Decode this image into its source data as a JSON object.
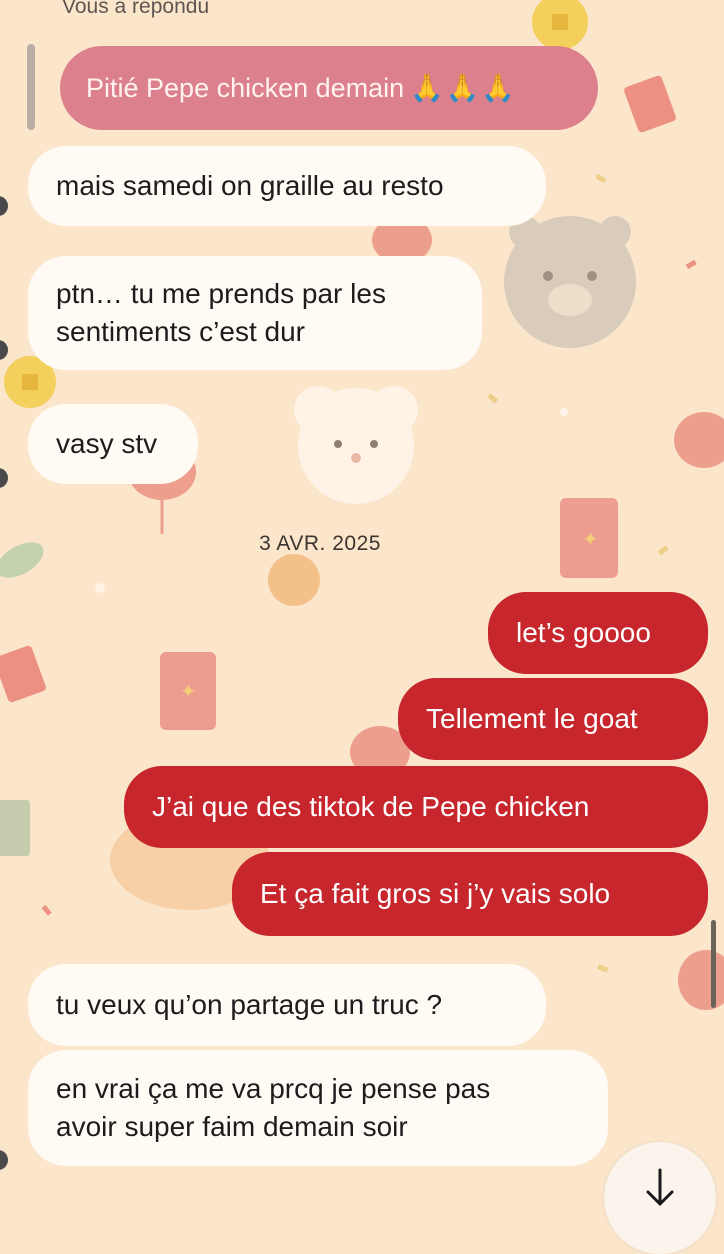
{
  "reply": {
    "label": "Vous a répondu",
    "text": "Pitié Pepe chicken demain",
    "emoji": "🙏🙏🙏"
  },
  "messages_before": [
    {
      "text": "mais samedi on graille au resto"
    },
    {
      "line1": "ptn… tu me prends par les",
      "line2": "sentiments c’est dur"
    },
    {
      "text": "vasy stv"
    }
  ],
  "date_separator": "3 AVR. 2025",
  "sent": [
    "let’s goooo",
    "Tellement le goat",
    "J’ai que des tiktok de Pepe chicken",
    "Et ça fait gros si j’y vais solo"
  ],
  "messages_after": [
    {
      "text": "tu veux qu’on partage un truc ?"
    },
    {
      "line1": "en vrai ça me va prcq je pense pas",
      "line2": "avoir super faim demain soir"
    }
  ],
  "colors": {
    "background": "#fbe6cc",
    "incoming_bubble": "#fffaf3",
    "outgoing_bubble": "#c7262d",
    "reply_bubble": "#db7b89"
  },
  "icons": {
    "scroll_down": "arrow-down-icon"
  }
}
